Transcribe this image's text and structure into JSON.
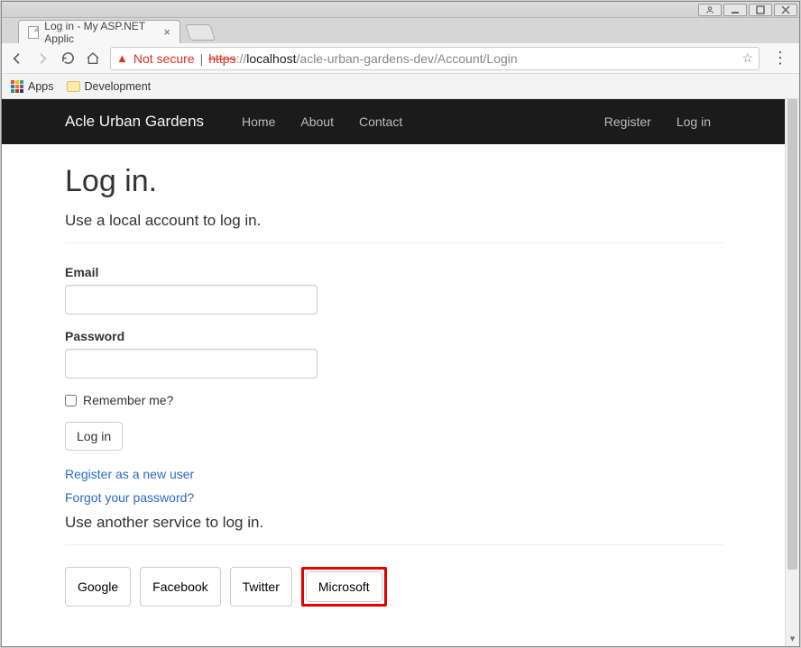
{
  "browser": {
    "tab_title": "Log in - My ASP.NET Applic",
    "not_secure_label": "Not secure",
    "url_scheme": "https",
    "url_host": "localhost",
    "url_path": "/acle-urban-gardens-dev/Account/Login",
    "apps_label": "Apps",
    "bookmark_folder": "Development"
  },
  "nav": {
    "brand": "Acle Urban Gardens",
    "links": [
      "Home",
      "About",
      "Contact"
    ],
    "right_links": [
      "Register",
      "Log in"
    ]
  },
  "page": {
    "heading": "Log in.",
    "subheading": "Use a local account to log in.",
    "email_label": "Email",
    "password_label": "Password",
    "remember_label": "Remember me?",
    "submit_label": "Log in",
    "register_link": "Register as a new user",
    "forgot_link": "Forgot your password?",
    "other_services_heading": "Use another service to log in.",
    "providers": [
      "Google",
      "Facebook",
      "Twitter",
      "Microsoft"
    ],
    "highlighted_provider": "Microsoft"
  }
}
